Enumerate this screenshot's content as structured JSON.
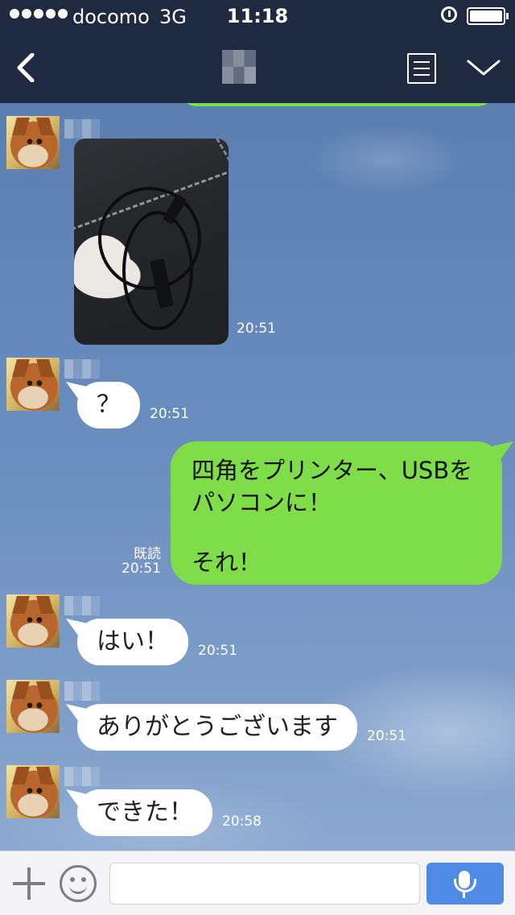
{
  "status_bar": {
    "carrier": "docomo",
    "network": "3G",
    "time": "11:18"
  },
  "nav": {
    "back_icon": "chevron-left-icon",
    "menu_icon": "list-icon",
    "expand_icon": "chevron-down-icon"
  },
  "messages": [
    {
      "type": "image",
      "direction": "in",
      "time": "20:51"
    },
    {
      "type": "text",
      "direction": "in",
      "text": "？",
      "time": "20:51"
    },
    {
      "type": "text",
      "direction": "out",
      "lines": [
        "四角をプリンター、USBを",
        "パソコンに！",
        "それ！"
      ],
      "read_label": "既読",
      "time": "20:51"
    },
    {
      "type": "text",
      "direction": "in",
      "text": "はい！",
      "time": "20:51"
    },
    {
      "type": "text",
      "direction": "in",
      "text": "ありがとうございます",
      "time": "20:51"
    },
    {
      "type": "text",
      "direction": "in",
      "text": "できた！",
      "time": "20:58"
    }
  ],
  "input_bar": {
    "plus_icon": "plus-icon",
    "sticker_icon": "smile-icon",
    "mic_icon": "microphone-icon",
    "placeholder": ""
  },
  "colors": {
    "header": "#1f2a40",
    "outgoing_bubble": "#7fdd4a",
    "incoming_bubble": "#ffffff",
    "mic_button": "#4f8ae6"
  }
}
